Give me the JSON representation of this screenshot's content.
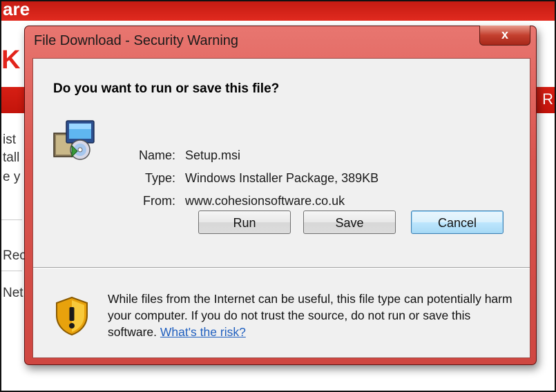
{
  "background": {
    "header_word": "are",
    "bar_right_text": "R",
    "brand_letter": "K",
    "left_fragments": [
      "ist",
      "tall",
      "e y",
      "Rec",
      "Net"
    ]
  },
  "dialog": {
    "title": "File Download - Security Warning",
    "close_label": "x",
    "question": "Do you want to run or save this file?",
    "icon": "installer-package-icon",
    "fields": {
      "name_label": "Name:",
      "name_value": "Setup.msi",
      "type_label": "Type:",
      "type_value": "Windows Installer Package, 389KB",
      "from_label": "From:",
      "from_value": "www.cohesionsoftware.co.uk"
    },
    "buttons": {
      "run": "Run",
      "save": "Save",
      "cancel": "Cancel"
    },
    "warning": {
      "icon": "shield-warning-icon",
      "text": "While files from the Internet can be useful, this file type can potentially harm your computer. If you do not trust the source, do not run or save this software.",
      "link": "What's the risk?"
    }
  },
  "colors": {
    "dialog_frame": "#d9544e",
    "background_red": "#e12a1f",
    "link": "#1f5fbf",
    "default_button_border": "#3c7fb1"
  }
}
